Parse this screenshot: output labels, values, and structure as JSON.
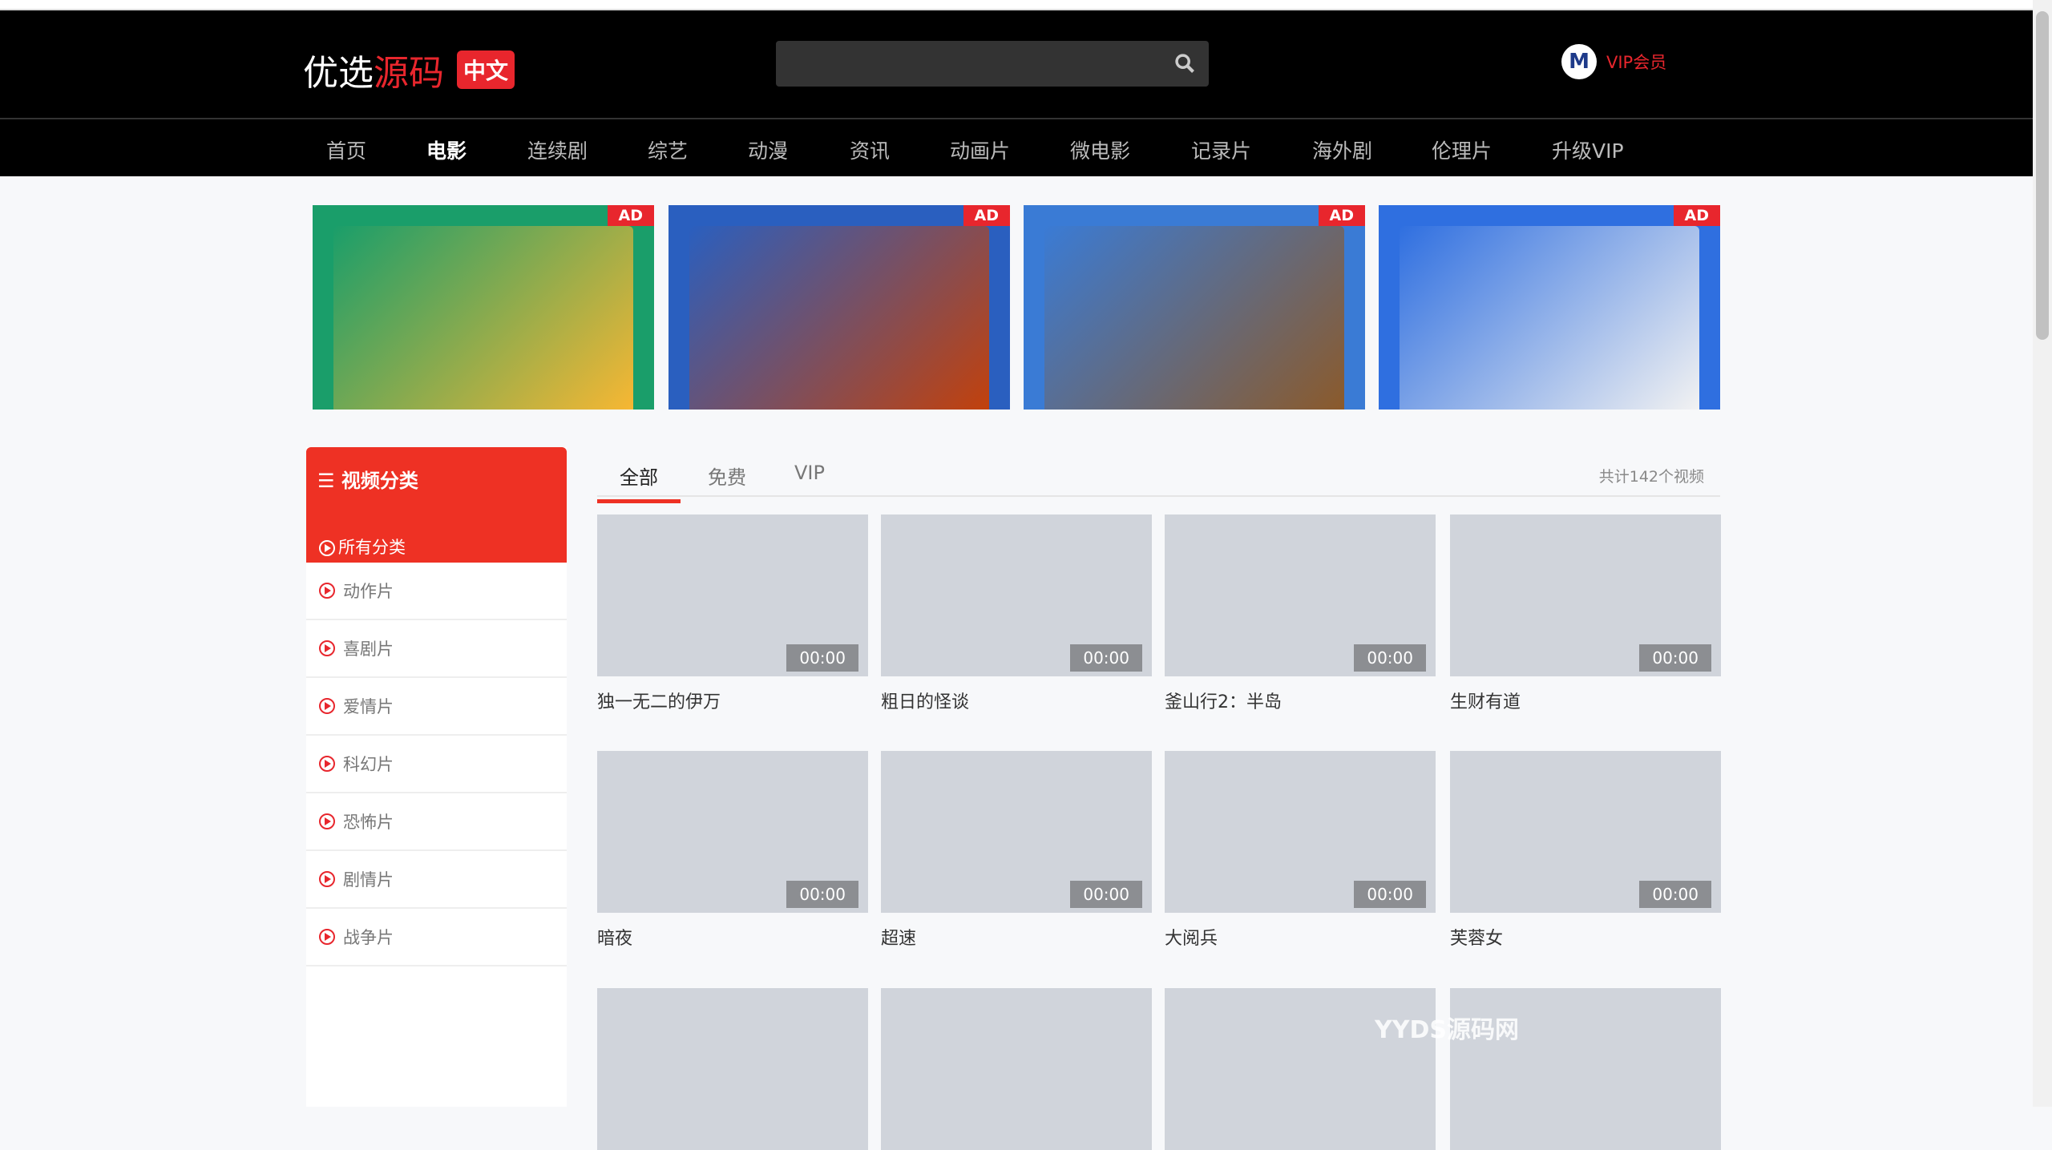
{
  "header": {
    "logo_white": "优选",
    "logo_red": "源码",
    "logo_badge": "中文",
    "search_placeholder": "",
    "vip_label": "VIP会员",
    "avatar_text": "M"
  },
  "nav": [
    "首页",
    "电影",
    "连续剧",
    "综艺",
    "动漫",
    "资讯",
    "动画片",
    "微电影",
    "记录片",
    "海外剧",
    "伦理片",
    "升级VIP"
  ],
  "nav_active": "电影",
  "ads": [
    {
      "tag": "AD",
      "colors": [
        "#1a9e6a",
        "#f7b733"
      ]
    },
    {
      "tag": "AD",
      "colors": [
        "#2a5fbf",
        "#c2410c"
      ]
    },
    {
      "tag": "AD",
      "colors": [
        "#3a7bd5",
        "#8b5a2b"
      ]
    },
    {
      "tag": "AD",
      "colors": [
        "#2f6fe0",
        "#f2f2f2"
      ]
    }
  ],
  "sidebar": {
    "title": "视频分类",
    "all": "所有分类",
    "items": [
      "动作片",
      "喜剧片",
      "爱情片",
      "科幻片",
      "恐怖片",
      "剧情片",
      "战争片"
    ]
  },
  "tabs": {
    "items": [
      "全部",
      "免费",
      "VIP"
    ],
    "active": "全部",
    "count": "共计142个视频"
  },
  "videos": [
    {
      "title": "独一无二的伊万",
      "duration": "00:00"
    },
    {
      "title": "粗日的怪谈",
      "duration": "00:00"
    },
    {
      "title": "釜山行2：半岛",
      "duration": "00:00"
    },
    {
      "title": "生财有道",
      "duration": "00:00"
    },
    {
      "title": "暗夜",
      "duration": "00:00"
    },
    {
      "title": "超速",
      "duration": "00:00"
    },
    {
      "title": "大阅兵",
      "duration": "00:00"
    },
    {
      "title": "芙蓉女",
      "duration": "00:00"
    },
    {
      "title": "",
      "duration": ""
    },
    {
      "title": "",
      "duration": ""
    },
    {
      "title": "",
      "duration": ""
    },
    {
      "title": "",
      "duration": ""
    }
  ],
  "watermark": "YYDS源码网",
  "colors": {
    "accent": "#ee3124",
    "header_bg": "#000000"
  }
}
